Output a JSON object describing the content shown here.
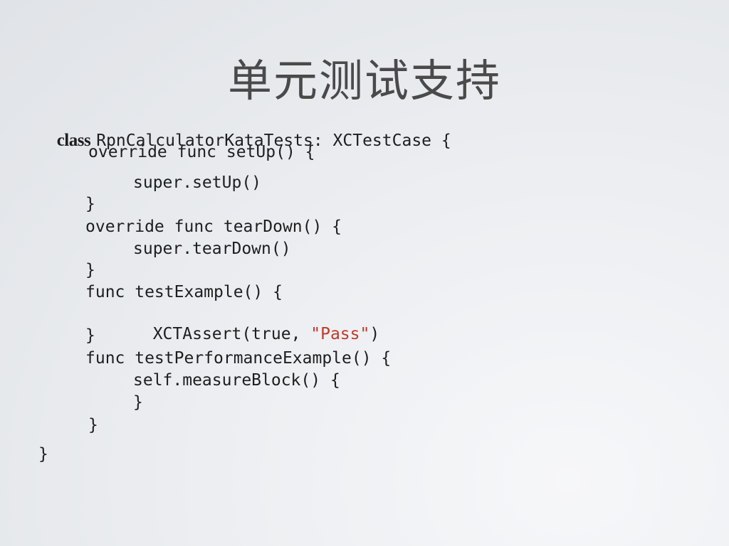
{
  "slide": {
    "title": "单元测试支持"
  },
  "code": {
    "class_keyword": "class",
    "class_decl": "RpnCalculatorKataTests: XCTestCase {",
    "setup_decl": "override func setUp() {",
    "setup_body": "super.setUp()",
    "setup_close": "}",
    "teardown_decl": "override func tearDown() {",
    "teardown_body": "super.tearDown()",
    "teardown_close": "}",
    "test_example_decl": "func testExample() {",
    "assert_prefix": "XCTAssert(true, ",
    "assert_string": "\"Pass\"",
    "assert_suffix": ")",
    "test_example_close": "}",
    "test_perf_decl": "func testPerformanceExample() {",
    "measure_block_decl": "self.measureBlock() {",
    "measure_block_close": "}",
    "test_perf_close": "}",
    "class_close": "}",
    "string_color": "#c0392b"
  }
}
